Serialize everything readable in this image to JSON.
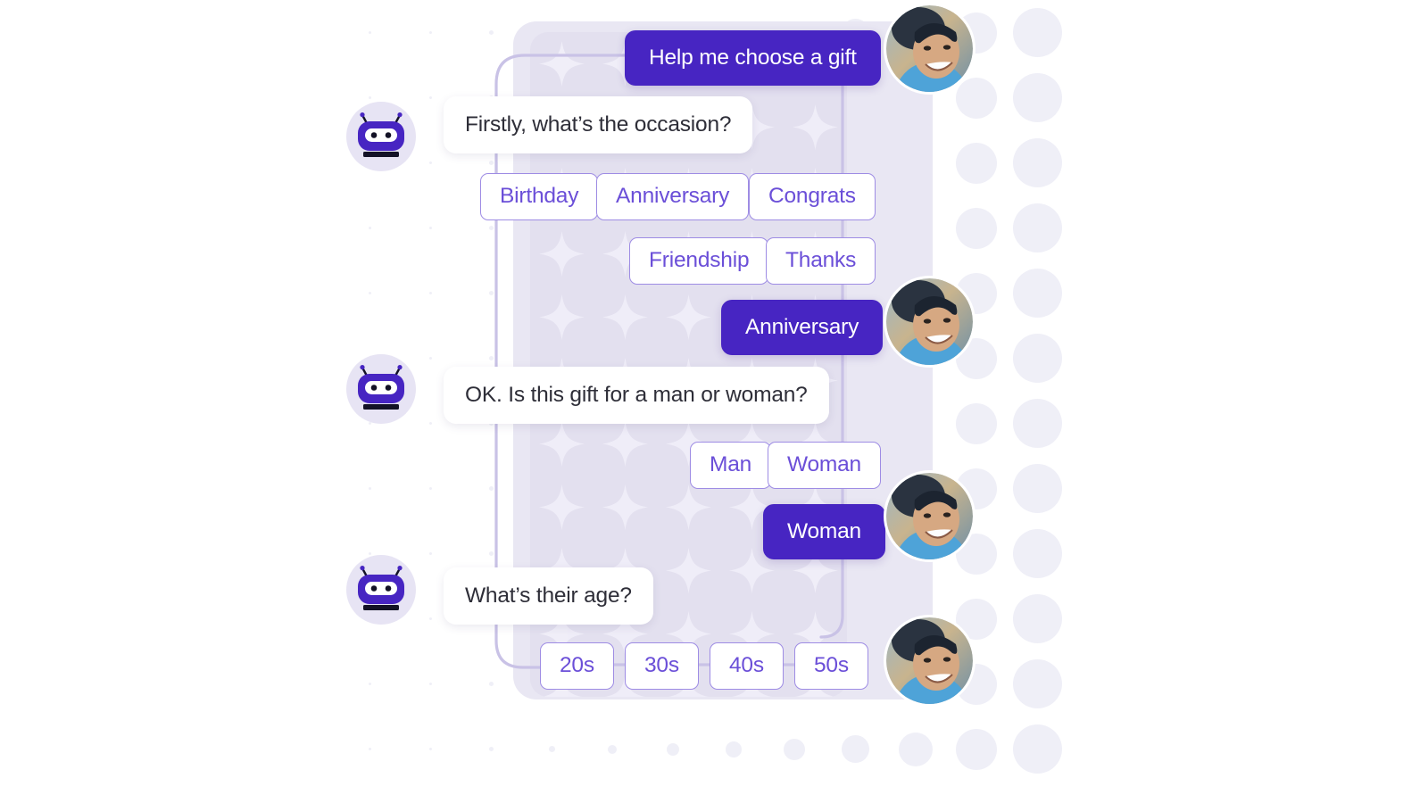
{
  "app": {
    "title": "Gift Recommendation Chatbot Conversation",
    "accent_purple": "#4725c2",
    "chip_border": "#9e8ce4",
    "chip_text": "#6b4fd8",
    "panel_lavender": "#e3e0ef",
    "dot_color": "#efeff7",
    "bot_avatar_bg": "#e7e4f4",
    "bubble_text": "#2e2e38"
  },
  "conversation": [
    {
      "id": "m1",
      "sender": "user",
      "kind": "message",
      "text": "Help me choose a gift",
      "avatar": "user-photo-avatar"
    },
    {
      "id": "m2",
      "sender": "bot",
      "kind": "message",
      "text": "Firstly, what’s the occasion?",
      "avatar": "bot-robot-avatar"
    },
    {
      "id": "m3",
      "sender": "bot",
      "kind": "options",
      "group": "occasion",
      "options": [
        "Birthday",
        "Anniversary",
        "Congrats",
        "Friendship",
        "Thanks"
      ]
    },
    {
      "id": "m4",
      "sender": "user",
      "kind": "selection",
      "text": "Anniversary",
      "avatar": "user-photo-avatar"
    },
    {
      "id": "m5",
      "sender": "bot",
      "kind": "message",
      "text": "OK. Is this gift for a man or woman?",
      "avatar": "bot-robot-avatar"
    },
    {
      "id": "m6",
      "sender": "bot",
      "kind": "options",
      "group": "gender",
      "options": [
        "Man",
        "Woman"
      ]
    },
    {
      "id": "m7",
      "sender": "user",
      "kind": "selection",
      "text": "Woman",
      "avatar": "user-photo-avatar"
    },
    {
      "id": "m8",
      "sender": "bot",
      "kind": "message",
      "text": "What’s their age?",
      "avatar": "bot-robot-avatar"
    },
    {
      "id": "m9",
      "sender": "bot",
      "kind": "options",
      "group": "age",
      "options": [
        "20s",
        "30s",
        "40s",
        "50s"
      ]
    }
  ],
  "messages": {
    "help_me_choose_a_gift": "Help me choose a gift",
    "firstly_occasion": "Firstly, what’s the occasion?",
    "ok_man_or_woman": "OK. Is this gift for a man or woman?",
    "whats_their_age": "What’s their age?",
    "selected_anniversary": "Anniversary",
    "selected_woman": "Woman"
  },
  "options": {
    "occasion": {
      "birthday": "Birthday",
      "anniversary": "Anniversary",
      "congrats": "Congrats",
      "friendship": "Friendship",
      "thanks": "Thanks"
    },
    "gender": {
      "man": "Man",
      "woman": "Woman"
    },
    "age": {
      "twenties": "20s",
      "thirties": "30s",
      "forties": "40s",
      "fifties": "50s"
    }
  },
  "icons": {
    "bot": "robot-head-icon",
    "user": "user-photo-avatar"
  }
}
